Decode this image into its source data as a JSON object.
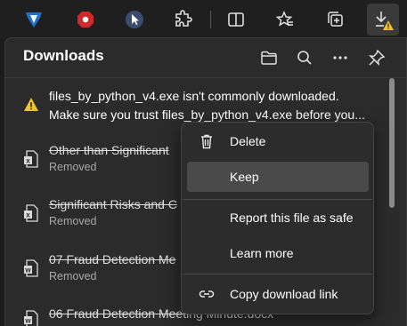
{
  "toolbar": {
    "icons": [
      "shield-extension-icon",
      "stop-extension-icon",
      "pointer-extension-icon",
      "extensions-icon",
      "split-screen-icon",
      "favorites-icon",
      "collections-icon",
      "downloads-warning-icon"
    ]
  },
  "panel": {
    "title": "Downloads",
    "header_icons": [
      "folder-icon",
      "search-icon",
      "more-icon",
      "pin-icon"
    ]
  },
  "warning": {
    "line1": "files_by_python_v4.exe isn't commonly downloaded.",
    "line2": "Make sure you trust files_by_python_v4.exe before you..."
  },
  "items": [
    {
      "name": "Other than Significant",
      "status": "Removed",
      "type": "excel"
    },
    {
      "name": "Significant Risks and C",
      "status": "Removed",
      "type": "excel"
    },
    {
      "name": "07 Fraud Detection Me",
      "status": "Removed",
      "type": "word"
    },
    {
      "name": "06 Fraud Detection Meeting Minute.docx",
      "status": "",
      "type": "word"
    }
  ],
  "context_menu": {
    "delete": "Delete",
    "keep": "Keep",
    "report": "Report this file as safe",
    "learn": "Learn more",
    "copy_link": "Copy download link"
  },
  "colors": {
    "warning": "#f2c12e",
    "excel": "#d9d9d9",
    "word": "#d9d9d9",
    "panel_bg": "#2b2b2b",
    "menu_bg": "#2c2c2c"
  }
}
